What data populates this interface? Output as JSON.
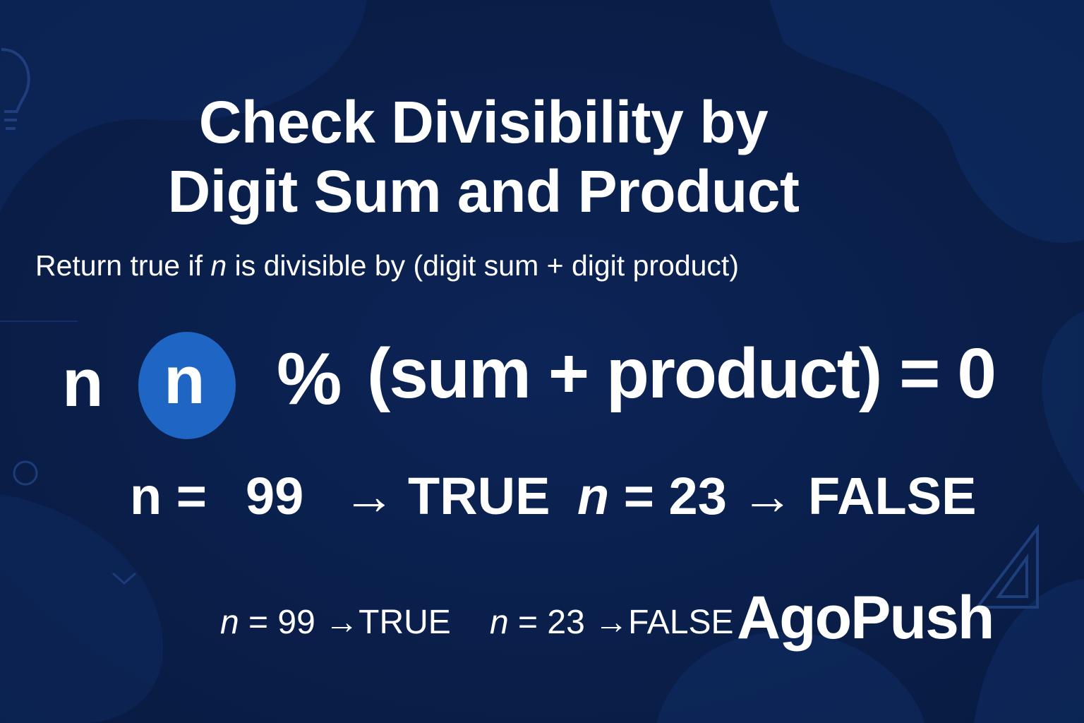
{
  "title": {
    "line1": "Check Divisibility by",
    "line2": "Digit Sum and Product"
  },
  "subtitle": {
    "before": "Return true if ",
    "var": "n",
    "after": " is divisible by (digit sum + digit product)"
  },
  "formula": {
    "n_plain": "n",
    "n_badge": "n",
    "percent": "%",
    "expression": "(sum + product) = 0"
  },
  "examples_large": {
    "ex1_lhs": "n =",
    "ex1_value": "99",
    "ex1_arrow": "→",
    "ex1_result": "TRUE",
    "ex2": "= 23 → FALSE",
    "ex2_var": "n"
  },
  "examples_small": {
    "ex1_var": "n",
    "ex1_text": " = 99 →TRUE",
    "ex2_var": "n",
    "ex2_text": " = 23 →FALSE"
  },
  "brand": {
    "logo": "AgoPush"
  },
  "colors": {
    "background": "#0a1f4a",
    "accent_circle": "#1f66c4",
    "text": "#ffffff"
  },
  "icons": {
    "top_left": "lightbulb-icon",
    "bottom_right": "set-square-icon"
  }
}
